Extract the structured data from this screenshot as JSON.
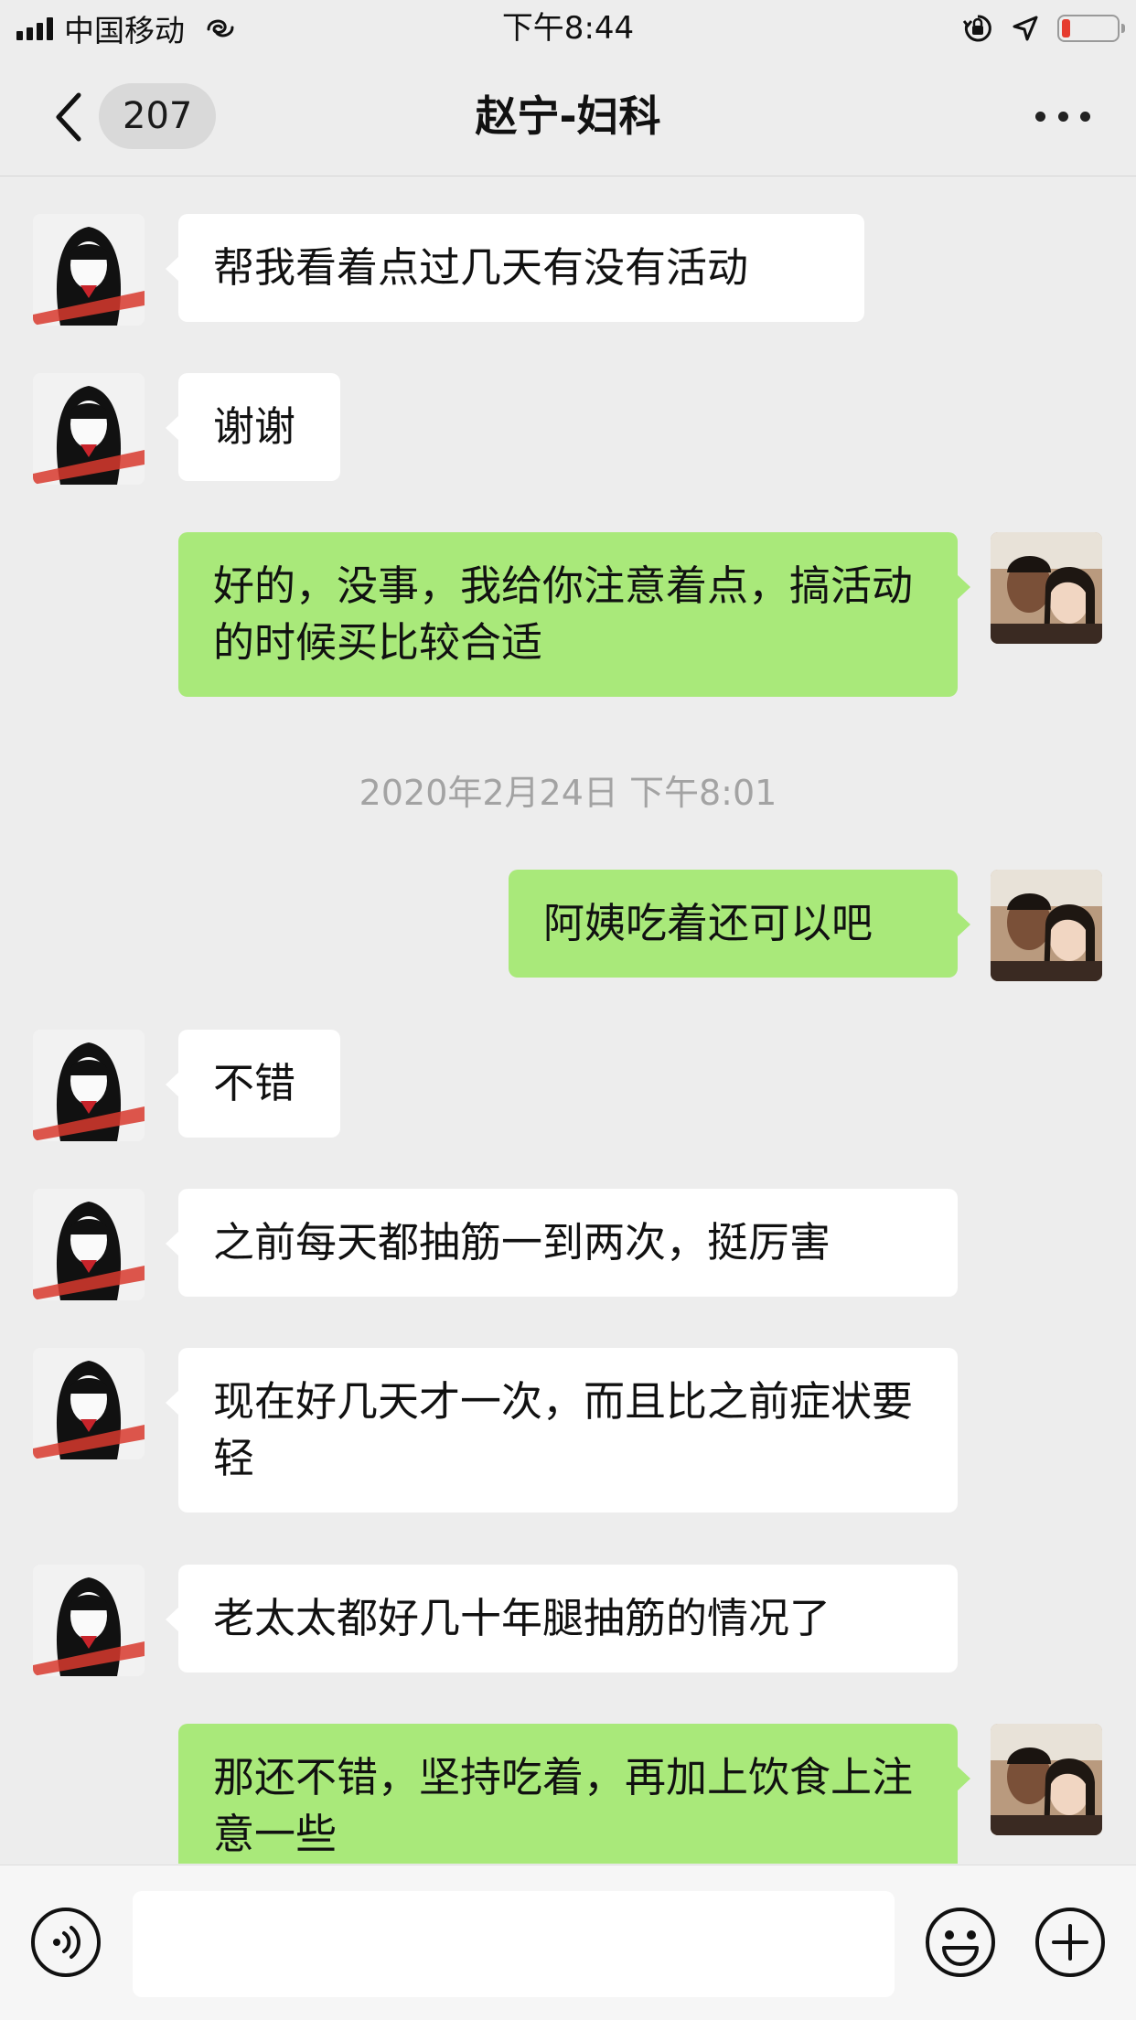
{
  "status_bar": {
    "carrier": "中国移动",
    "time": "下午8:44",
    "battery_level": 0.15,
    "battery_color": "#e63b2e"
  },
  "nav": {
    "unread_count": "207",
    "title": "赵宁-妇科"
  },
  "colors": {
    "background": "#ededed",
    "incoming_bubble": "#ffffff",
    "outgoing_bubble": "#a9e97a"
  },
  "messages": [
    {
      "side": "left",
      "text": "帮我看着点过几天有没有活动"
    },
    {
      "side": "left",
      "text": "谢谢"
    },
    {
      "side": "right",
      "text": "好的，没事，我给你注意着点，搞活动的时候买比较合适"
    },
    {
      "type": "time",
      "text": "2020年2月24日 下午8:01"
    },
    {
      "side": "right",
      "text": "阿姨吃着还可以吧"
    },
    {
      "side": "left",
      "text": "不错"
    },
    {
      "side": "left",
      "text": "之前每天都抽筋一到两次，挺厉害"
    },
    {
      "side": "left",
      "text": "现在好几天才一次，而且比之前症状要轻"
    },
    {
      "side": "left",
      "text": "老太太都好几十年腿抽筋的情况了"
    },
    {
      "side": "right",
      "text": "那还不错，坚持吃着，再加上饮食上注意一些"
    }
  ],
  "input": {
    "value": ""
  }
}
